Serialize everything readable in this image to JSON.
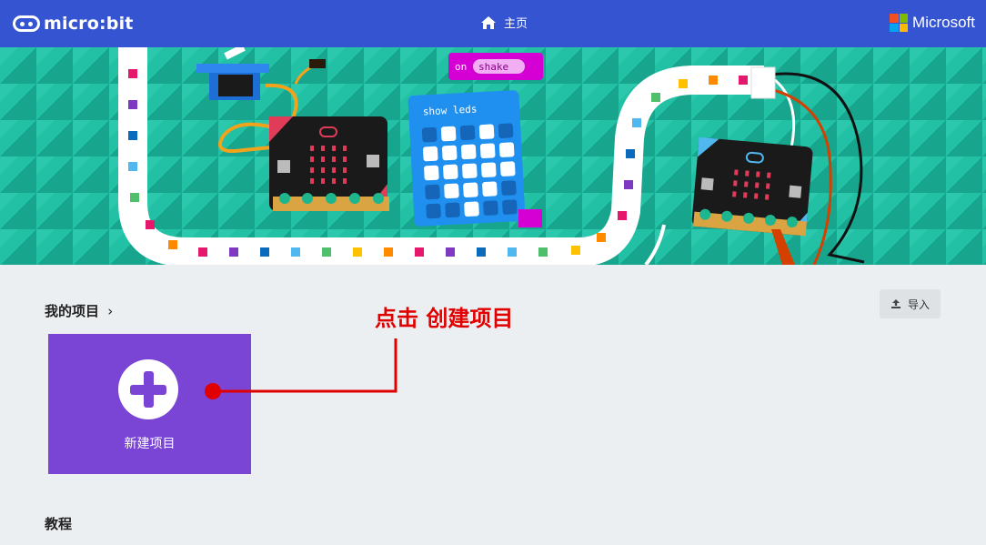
{
  "header": {
    "logo_text": "micro:bit",
    "home_label": "主页",
    "brand": "Microsoft",
    "brand_colors": [
      "#f25022",
      "#7fba00",
      "#00a4ef",
      "#ffb900"
    ],
    "bar_color": "#3454d1"
  },
  "hero": {
    "code_block_event": "on",
    "code_block_dropdown": "shake",
    "code_block_leds": "show leds"
  },
  "projects": {
    "title": "我的项目",
    "chevron": "›",
    "import_label": "导入",
    "new_project_label": "新建项目",
    "new_project_color": "#7a44d4"
  },
  "annotation": {
    "text": "点击 创建项目",
    "color": "#e00000"
  },
  "tutorials": {
    "title": "教程"
  }
}
